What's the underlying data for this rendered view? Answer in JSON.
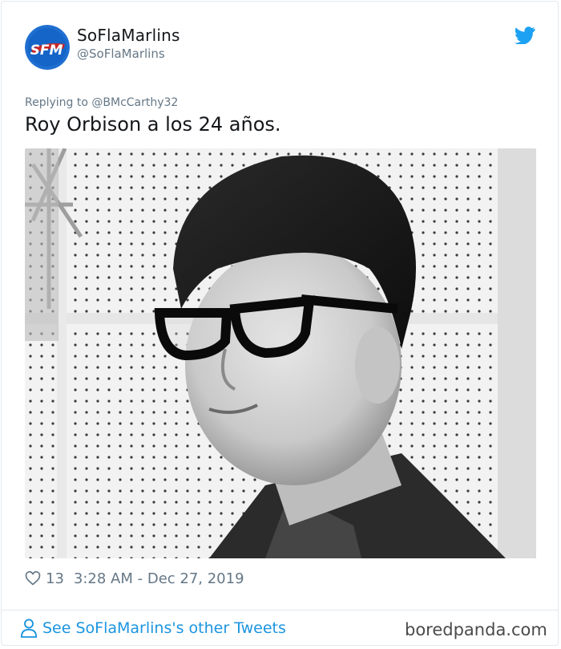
{
  "tweet": {
    "display_name": "SoFlaMarlins",
    "handle": "@SoFlaMarlins",
    "avatar_text": "SFM",
    "reply_prefix": "Replying to",
    "reply_to": "@BMcCarthy32",
    "text": "Roy Orbison a los 24 años.",
    "likes": "13",
    "timestamp": "3:28 AM - Dec 27, 2019"
  },
  "footer": {
    "other_tweets_link": "See SoFlaMarlins's other Tweets"
  },
  "watermark": "boredpanda.com",
  "colors": {
    "link": "#1b95e0",
    "secondary_text": "#657786",
    "primary_text": "#14171a",
    "avatar_bg": "#1f6fd1",
    "border": "#e1e8ed"
  },
  "icons": {
    "brand": "twitter-bird-icon",
    "like": "heart-icon",
    "profile": "person-icon"
  }
}
